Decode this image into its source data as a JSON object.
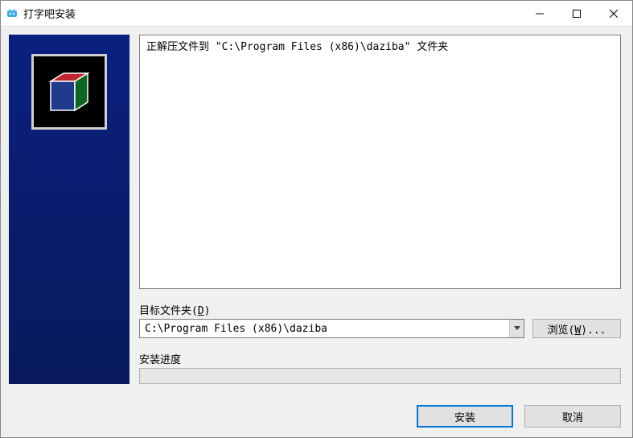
{
  "window": {
    "title": "打字吧安装"
  },
  "log": {
    "line1": "正解压文件到 \"C:\\Program Files (x86)\\daziba\" 文件夹"
  },
  "destination": {
    "label_prefix": "目标文件夹(",
    "label_key": "D",
    "label_suffix": ")",
    "value": "C:\\Program Files (x86)\\daziba",
    "browse_prefix": "浏览(",
    "browse_key": "W",
    "browse_suffix": ")..."
  },
  "progress": {
    "label": "安装进度"
  },
  "footer": {
    "install": "安装",
    "cancel": "取消"
  }
}
